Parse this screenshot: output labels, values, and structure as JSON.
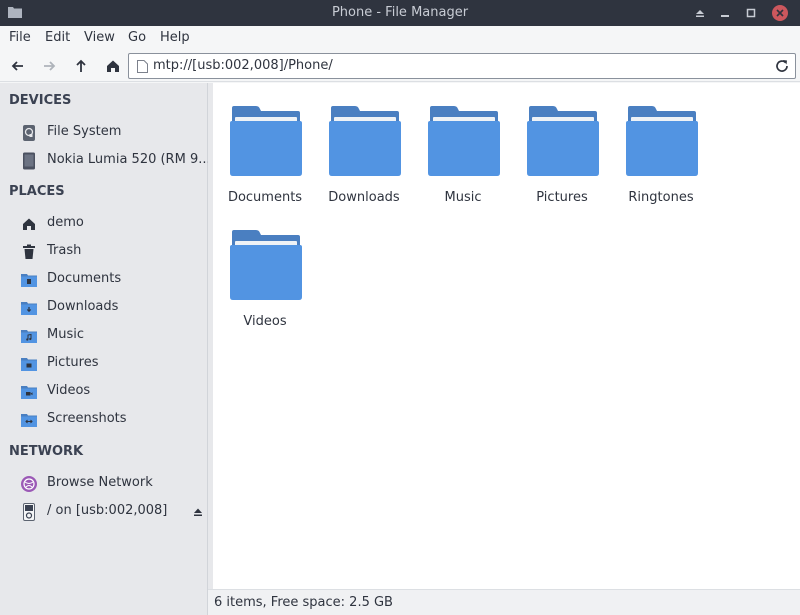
{
  "window": {
    "title": "Phone - File Manager"
  },
  "menubar": {
    "items": [
      {
        "label": "File"
      },
      {
        "label": "Edit"
      },
      {
        "label": "View"
      },
      {
        "label": "Go"
      },
      {
        "label": "Help"
      }
    ]
  },
  "toolbar": {
    "back_icon": "arrow-left-icon",
    "forward_icon": "arrow-right-icon",
    "up_icon": "arrow-up-icon",
    "home_icon": "home-icon",
    "location": "mtp://[usb:002,008]/Phone/",
    "reload_icon": "reload-icon"
  },
  "sidebar": {
    "devices_heading": "DEVICES",
    "devices": [
      {
        "label": "File System",
        "icon": "disk-icon"
      },
      {
        "label": "Nokia Lumia 520 (RM 9...",
        "icon": "phone-icon"
      }
    ],
    "places_heading": "PLACES",
    "places": [
      {
        "label": "demo",
        "icon": "home-icon"
      },
      {
        "label": "Trash",
        "icon": "trash-icon"
      },
      {
        "label": "Documents",
        "icon": "folder-documents-icon"
      },
      {
        "label": "Downloads",
        "icon": "folder-downloads-icon"
      },
      {
        "label": "Music",
        "icon": "folder-music-icon"
      },
      {
        "label": "Pictures",
        "icon": "folder-pictures-icon"
      },
      {
        "label": "Videos",
        "icon": "folder-videos-icon"
      },
      {
        "label": "Screenshots",
        "icon": "folder-screenshots-icon"
      }
    ],
    "network_heading": "NETWORK",
    "network": [
      {
        "label": "Browse Network",
        "icon": "network-icon"
      },
      {
        "label": "/ on [usb:002,008]",
        "icon": "media-player-icon"
      }
    ]
  },
  "main": {
    "folders": [
      {
        "label": "Documents"
      },
      {
        "label": "Downloads"
      },
      {
        "label": "Music"
      },
      {
        "label": "Pictures"
      },
      {
        "label": "Ringtones"
      },
      {
        "label": "Videos"
      }
    ]
  },
  "status": {
    "text": "6 items, Free space: 2.5 GB"
  },
  "colors": {
    "folder": "#5294e2",
    "folder_dark": "#4a7fc1",
    "titlebar": "#2f343f",
    "close_button": "#cc575d"
  }
}
